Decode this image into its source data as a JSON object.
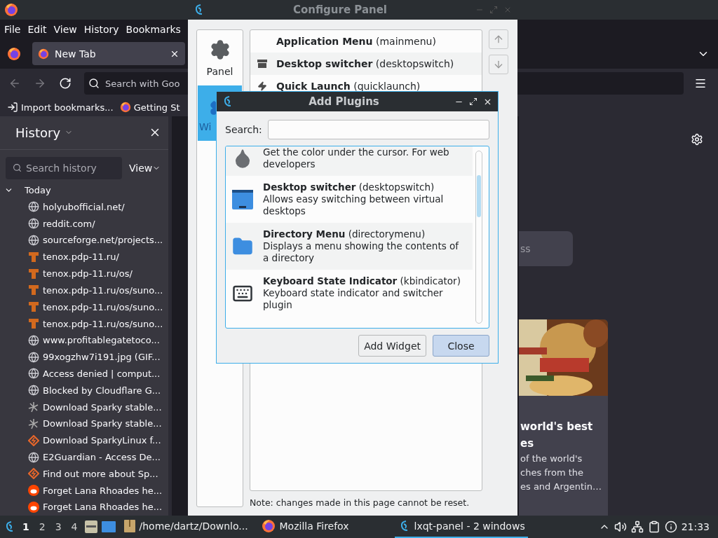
{
  "firefox": {
    "menu": [
      "File",
      "Edit",
      "View",
      "History",
      "Bookmarks"
    ],
    "tabs": [
      {
        "label": "New Tab",
        "selected": true
      }
    ],
    "url_placeholder": "Search with Goo",
    "bookmarks": [
      {
        "kind": "import",
        "label": "Import bookmarks..."
      },
      {
        "kind": "firefox",
        "label": "Getting St"
      }
    ],
    "sidebar": {
      "title": "History",
      "search_placeholder": "Search history",
      "view_button": "View",
      "groups": [
        {
          "label": "Today",
          "expanded": true,
          "children": [
            {
              "kind": "globe",
              "label": "holyubofficial.net/"
            },
            {
              "kind": "globe",
              "label": "reddit.com/"
            },
            {
              "kind": "globe",
              "label": "sourceforge.net/projects..."
            },
            {
              "kind": "tenox",
              "label": "tenox.pdp-11.ru/"
            },
            {
              "kind": "tenox",
              "label": "tenox.pdp-11.ru/os/"
            },
            {
              "kind": "tenox",
              "label": "tenox.pdp-11.ru/os/suno..."
            },
            {
              "kind": "tenox",
              "label": "tenox.pdp-11.ru/os/suno..."
            },
            {
              "kind": "tenox",
              "label": "tenox.pdp-11.ru/os/suno..."
            },
            {
              "kind": "globe",
              "label": "www.profitablegatetoco..."
            },
            {
              "kind": "globe",
              "label": "99xogzhw7i191.jpg (GIF..."
            },
            {
              "kind": "globe",
              "label": "Access denied | comput..."
            },
            {
              "kind": "globe",
              "label": "Blocked by Cloudflare G..."
            },
            {
              "kind": "sparky",
              "label": "Download Sparky stable..."
            },
            {
              "kind": "sparky",
              "label": "Download Sparky stable..."
            },
            {
              "kind": "sparkylinux",
              "label": "Download SparkyLinux f..."
            },
            {
              "kind": "globe",
              "label": "E2Guardian - Access De..."
            },
            {
              "kind": "sparkylinux",
              "label": "Find out more about Sp..."
            },
            {
              "kind": "reddit",
              "label": "Forget Lana Rhoades he..."
            },
            {
              "kind": "reddit",
              "label": "Forget Lana Rhoades he..."
            }
          ]
        }
      ]
    },
    "newtab": {
      "search_placeholder": "ss",
      "card": {
        "title_lines": [
          "world's best",
          "es"
        ],
        "description_lines": [
          "of the world's",
          "ches from the",
          "es and Argentin…"
        ]
      }
    }
  },
  "configure_panel": {
    "title": "Configure Panel",
    "sections": [
      {
        "kind": "panel",
        "label": "Panel",
        "selected": false
      },
      {
        "kind": "widgets",
        "label": "Wi",
        "selected": true
      }
    ],
    "widgets": [
      {
        "kind": "none",
        "text": "**Application Menu** (mainmenu)"
      },
      {
        "kind": "desktop",
        "text": "**Desktop switcher** (desktopswitch)"
      },
      {
        "kind": "launch",
        "text": "**Quick Launch** (quicklaunch)"
      }
    ],
    "note": "Note: changes made in this page cannot be reset."
  },
  "add_plugins": {
    "title": "Add Plugins",
    "search_label": "Search:",
    "plugins": [
      {
        "kind": "dropper",
        "description": "Get the color under the cursor. For web developers"
      },
      {
        "kind": "desktop",
        "text": "**Desktop switcher** (desktopswitch)",
        "description": "Allows easy switching between virtual desktops"
      },
      {
        "kind": "folder",
        "text": "**Directory Menu** (directorymenu)",
        "description": "Displays a menu showing the contents of a directory"
      },
      {
        "kind": "keyboard",
        "text": "**Keyboard State Indicator** (kbindicator)",
        "description": "Keyboard state indicator and switcher plugin"
      }
    ],
    "buttons": [
      {
        "label": "Add Widget",
        "default": false
      },
      {
        "label": "Close",
        "default": true
      }
    ]
  },
  "taskbar": {
    "desktops": [
      {
        "label": "1",
        "selected": true
      },
      {
        "label": "2",
        "selected": false
      },
      {
        "label": "3",
        "selected": false
      },
      {
        "label": "4",
        "selected": false
      }
    ],
    "tasks": [
      {
        "kind": "archive",
        "label": "/home/dartz/Downlo...",
        "selected": false
      },
      {
        "kind": "firefox",
        "label": "Mozilla Firefox",
        "selected": false
      },
      {
        "kind": "lxqt",
        "label": "lxqt-panel - 2 windows",
        "selected": true
      }
    ],
    "clock": "21:33"
  }
}
